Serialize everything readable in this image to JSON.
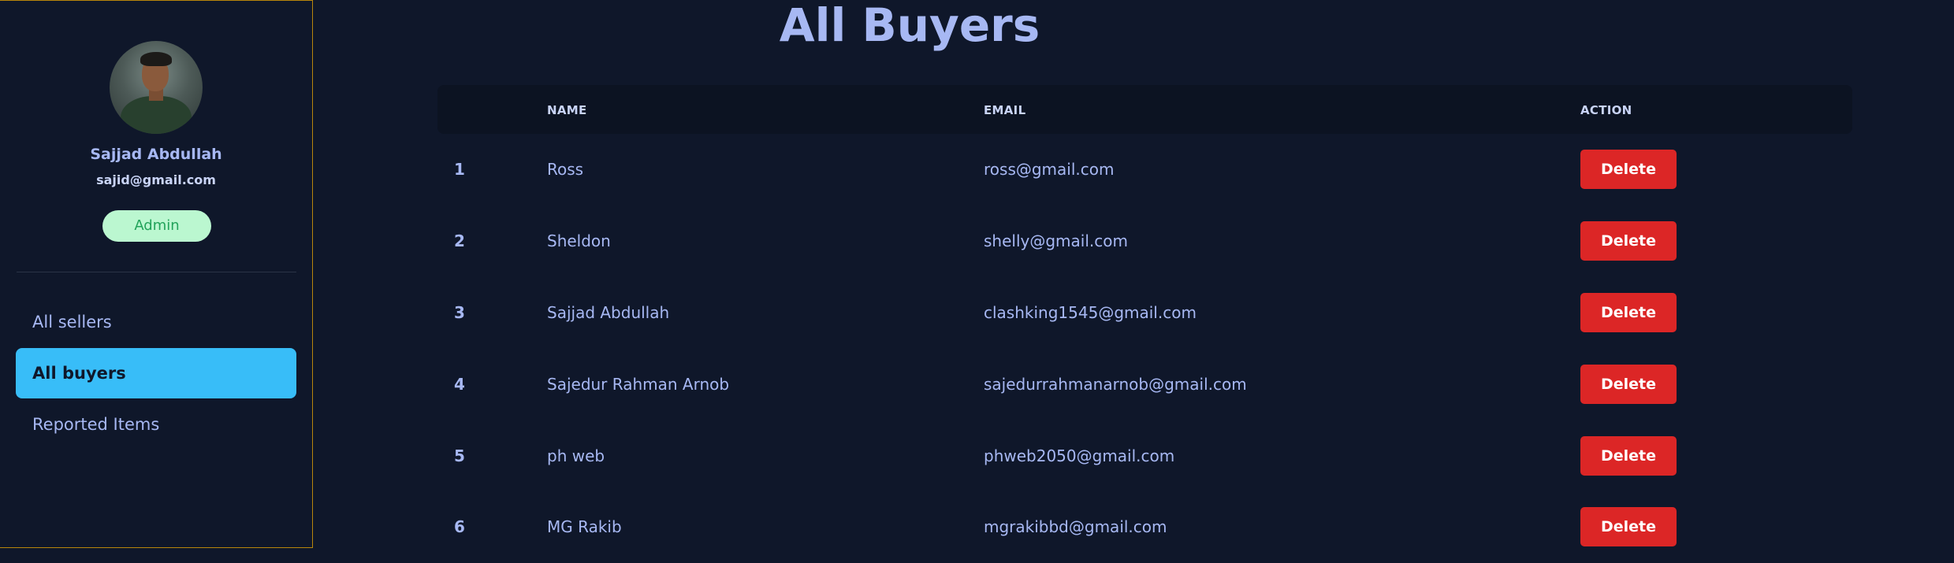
{
  "sidebar": {
    "user": {
      "name": "Sajjad Abdullah",
      "email": "sajid@gmail.com",
      "role": "Admin"
    },
    "nav": [
      {
        "label": "All sellers",
        "active": false
      },
      {
        "label": "All buyers",
        "active": true
      },
      {
        "label": "Reported Items",
        "active": false
      }
    ]
  },
  "main": {
    "title": "All Buyers",
    "columns": [
      "",
      "NAME",
      "EMAIL",
      "ACTION"
    ],
    "rows": [
      {
        "index": "1",
        "name": "Ross",
        "email": "ross@gmail.com",
        "action": "Delete"
      },
      {
        "index": "2",
        "name": "Sheldon",
        "email": "shelly@gmail.com",
        "action": "Delete"
      },
      {
        "index": "3",
        "name": "Sajjad Abdullah",
        "email": "clashking1545@gmail.com",
        "action": "Delete"
      },
      {
        "index": "4",
        "name": "Sajedur Rahman Arnob",
        "email": "sajedurrahmanarnob@gmail.com",
        "action": "Delete"
      },
      {
        "index": "5",
        "name": "ph web",
        "email": "phweb2050@gmail.com",
        "action": "Delete"
      },
      {
        "index": "6",
        "name": "MG Rakib",
        "email": "mgrakibbd@gmail.com",
        "action": "Delete"
      }
    ]
  },
  "colors": {
    "background": "#0f172a",
    "accent": "#38bdf8",
    "text": "#a7b8f3",
    "danger": "#dc2626",
    "badge_bg": "#bbf7d0",
    "badge_text": "#22a35a",
    "sidebar_border": "#b8860b"
  }
}
